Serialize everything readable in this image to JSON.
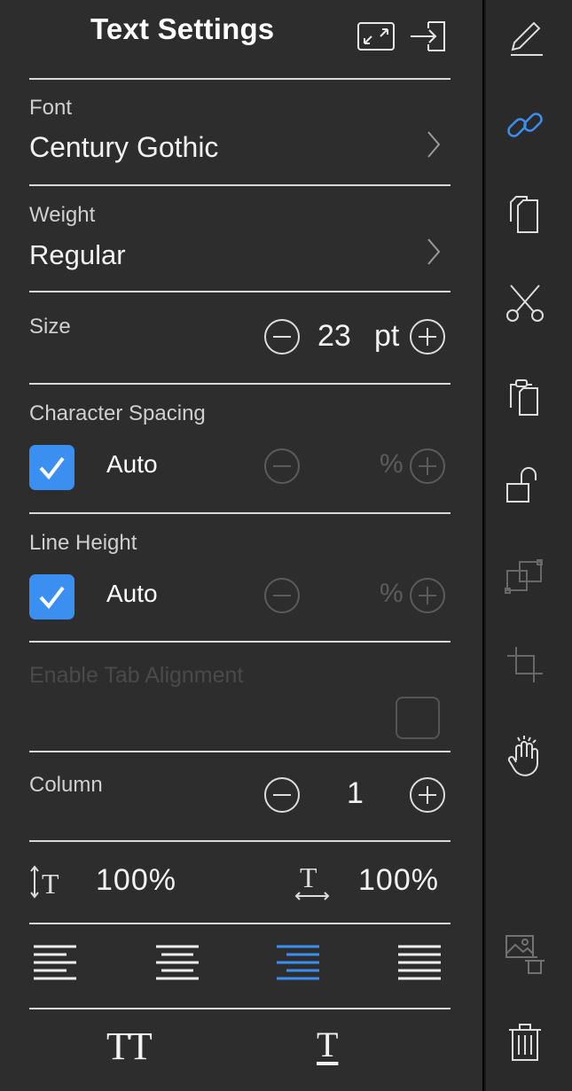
{
  "header": {
    "title": "Text Settings",
    "icons": [
      "collapse-icon",
      "exit-icon"
    ]
  },
  "font": {
    "label": "Font",
    "value": "Century Gothic"
  },
  "weight": {
    "label": "Weight",
    "value": "Regular"
  },
  "size": {
    "label": "Size",
    "value": "23",
    "unit": "pt"
  },
  "character_spacing": {
    "label": "Character Spacing",
    "auto_label": "Auto",
    "auto_checked": true,
    "unit": "%"
  },
  "line_height": {
    "label": "Line Height",
    "auto_label": "Auto",
    "auto_checked": true,
    "unit": "%"
  },
  "tab_alignment": {
    "label": "Enable Tab Alignment",
    "checked": false
  },
  "column": {
    "label": "Column",
    "value": "1"
  },
  "scale": {
    "vertical_value": "100%",
    "horizontal_value": "100%"
  },
  "alignment": {
    "options": [
      "left",
      "center",
      "right",
      "justify"
    ],
    "selected": "right"
  },
  "format": {
    "caps_label": "TT",
    "underline_label": "T"
  },
  "rail": {
    "icons": [
      "pencil-icon",
      "link-icon",
      "copy-icon",
      "scissors-icon",
      "paste-icon",
      "unlock-icon",
      "group-icon",
      "crop-icon",
      "hand-icon",
      "delete-image-icon",
      "trash-icon"
    ]
  },
  "colors": {
    "accent": "#3a8ff0",
    "panel": "#2d2d2d",
    "divider": "#d8d8d8"
  }
}
